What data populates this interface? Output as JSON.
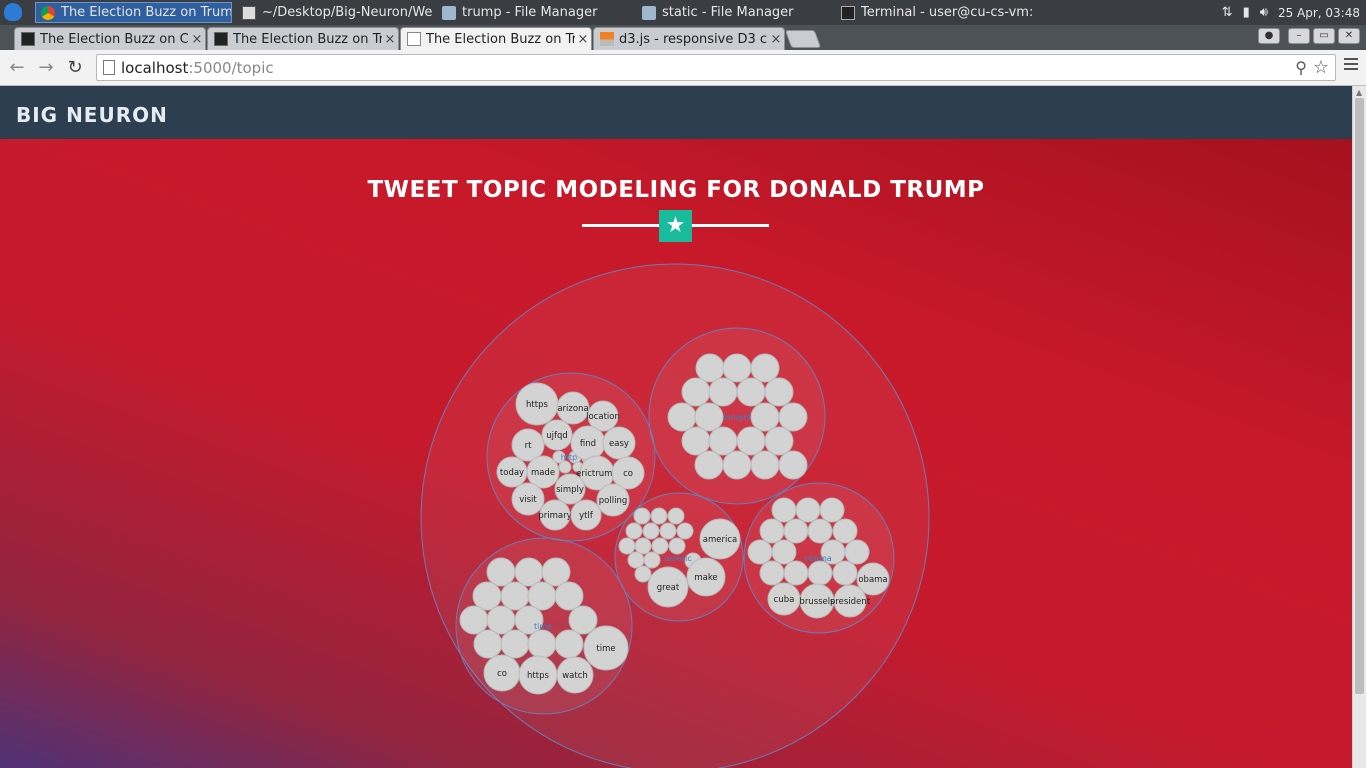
{
  "taskbar": {
    "tasks": [
      {
        "label": "The Election Buzz on Trum...",
        "icon": "chrome-icon",
        "active": true
      },
      {
        "label": "~/Desktop/Big-Neuron/We...",
        "icon": "text-editor-icon",
        "active": false
      },
      {
        "label": "trump - File Manager",
        "icon": "folder-icon",
        "active": false
      },
      {
        "label": "static - File Manager",
        "icon": "folder-icon",
        "active": false
      },
      {
        "label": "Terminal - user@cu-cs-vm: ...",
        "icon": "terminal-icon",
        "active": false
      }
    ],
    "clock": "25 Apr, 03:48"
  },
  "browser": {
    "tabs": [
      {
        "label": "The Election Buzz on Cli",
        "icon": "terminal-favicon",
        "selected": false
      },
      {
        "label": "The Election Buzz on Tru",
        "icon": "terminal-favicon",
        "selected": false
      },
      {
        "label": "The Election Buzz on Tru",
        "icon": "page-favicon",
        "selected": true
      },
      {
        "label": "d3.js - responsive D3 cha",
        "icon": "stackoverflow-favicon",
        "selected": false
      }
    ],
    "close_glyph": "×",
    "url_host": "localhost",
    "url_path": ":5000/topic"
  },
  "page": {
    "brand": "BIG NEURON",
    "title": "TWEET TOPIC MODELING FOR DONALD TRUMP",
    "colors": {
      "navbar": "#2c3e50",
      "accent": "#18bc9c",
      "bubble": "#d3d3d3",
      "cluster_stroke": "#6a7db6",
      "cluster_label": "#3d7fc4"
    }
  },
  "chart_data": {
    "type": "circle-packing",
    "root_label": "",
    "clusters": [
      {
        "label": "http",
        "words": [
          "https",
          "arizona",
          "location",
          "ujfqd",
          "find",
          "easy",
          "rt",
          "today",
          "made",
          "erictrump",
          "co",
          "simply",
          "visit",
          "polling",
          "primary",
          "ytlf"
        ]
      },
      {
        "label": "tonight",
        "words": []
      },
      {
        "label": "americ",
        "words": [
          "america",
          "make",
          "great"
        ]
      },
      {
        "label": "obama",
        "words": [
          "obama",
          "cuba",
          "brussels",
          "president"
        ]
      },
      {
        "label": "time",
        "words": [
          "time",
          "co",
          "https",
          "watch"
        ]
      }
    ]
  }
}
